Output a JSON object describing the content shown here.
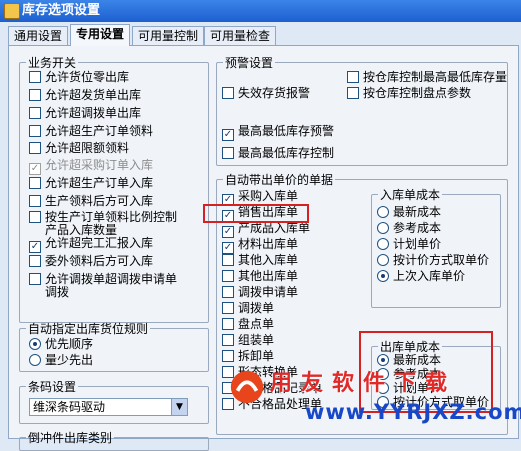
{
  "window": {
    "title": "库存选项设置",
    "icon": "app-icon"
  },
  "tabs": [
    "通用设置",
    "专用设置",
    "可用量控制",
    "可用量检查"
  ],
  "active_tab": "专用设置",
  "business_switch": {
    "legend": "业务开关",
    "items": [
      {
        "label": "允许货位零出库",
        "checked": false,
        "disabled": false
      },
      {
        "label": "允许超发货单出库",
        "checked": false,
        "disabled": false
      },
      {
        "label": "允许超调拨单出库",
        "checked": false,
        "disabled": false
      },
      {
        "label": "允许超生产订单领料",
        "checked": false,
        "disabled": false
      },
      {
        "label": "允许超限额领料",
        "checked": false,
        "disabled": false
      },
      {
        "label": "允许超采购订单入库",
        "checked": true,
        "disabled": true
      },
      {
        "label": "允许超生产订单入库",
        "checked": false,
        "disabled": false
      },
      {
        "label": "生产领料后方可入库",
        "checked": false,
        "disabled": false
      },
      {
        "label": "按生产订单领料比例控制产品入库数量",
        "line1": "按生产订单领料比例控制",
        "line2": "产品入库数量",
        "checked": false,
        "disabled": false
      },
      {
        "label": "允许超完工汇报入库",
        "checked": true,
        "disabled": false
      },
      {
        "label": "委外领料后方可入库",
        "checked": false,
        "disabled": false
      },
      {
        "label": "允许调拨单超调拨申请单调拨",
        "line1": "允许调拨单超调拨申请单",
        "line2": "调拨",
        "checked": false,
        "disabled": false
      }
    ]
  },
  "auto_location": {
    "legend": "自动指定出库货位规则",
    "options": [
      {
        "label": "优先顺序",
        "selected": true
      },
      {
        "label": "量少先出",
        "selected": false
      }
    ]
  },
  "barcode": {
    "legend": "条码设置",
    "selected": "维深条码驱动"
  },
  "return_category": {
    "legend": "倒冲件出库类别"
  },
  "warning": {
    "legend": "预警设置",
    "items": [
      {
        "label": "失效存货报警",
        "checked": false
      },
      {
        "label": "按仓库控制最高最低库存量",
        "checked": false
      },
      {
        "label": "按仓库控制盘点参数",
        "checked": false
      },
      {
        "label": "最高最低库存预警",
        "checked": true
      },
      {
        "label": "最高最低库存控制",
        "checked": false
      }
    ]
  },
  "auto_price_docs": {
    "legend": "自动带出单价的单据",
    "items": [
      {
        "label": "采购入库单",
        "checked": true
      },
      {
        "label": "销售出库单",
        "checked": true
      },
      {
        "label": "产成品入库单",
        "checked": true
      },
      {
        "label": "材料出库单",
        "checked": true
      },
      {
        "label": "其他入库单",
        "checked": false
      },
      {
        "label": "其他出库单",
        "checked": false
      },
      {
        "label": "调拨申请单",
        "checked": false
      },
      {
        "label": "调拨单",
        "checked": false
      },
      {
        "label": "盘点单",
        "checked": false
      },
      {
        "label": "组装单",
        "checked": false
      },
      {
        "label": "拆卸单",
        "checked": false
      },
      {
        "label": "形态转换单",
        "checked": false
      },
      {
        "label": "不合格品记录单",
        "checked": false
      },
      {
        "label": "不合格品处理单",
        "checked": false
      }
    ]
  },
  "inbound_cost": {
    "legend": "入库单成本",
    "options": [
      {
        "label": "最新成本",
        "selected": false
      },
      {
        "label": "参考成本",
        "selected": false
      },
      {
        "label": "计划单价",
        "selected": false
      },
      {
        "label": "按计价方式取单价",
        "selected": false
      },
      {
        "label": "上次入库单价",
        "selected": true
      }
    ]
  },
  "outbound_cost": {
    "legend": "出库单成本",
    "options": [
      {
        "label": "最新成本",
        "selected": true
      },
      {
        "label": "参考成本",
        "selected": false
      },
      {
        "label": "计划单价",
        "selected": false
      },
      {
        "label": "按计价方式取单价",
        "selected": false
      }
    ]
  },
  "watermark": {
    "text": "用友软件下载",
    "url": "www.YYRJXZ.com"
  },
  "accent": {
    "title_bar": "#1d5fd0",
    "highlight": "#d42121"
  }
}
